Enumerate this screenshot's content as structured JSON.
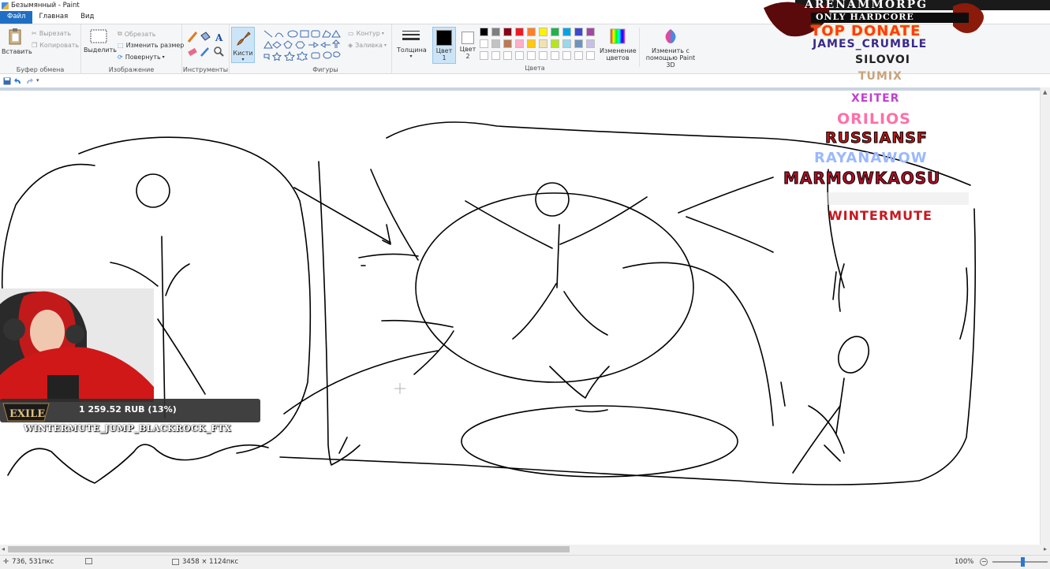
{
  "window": {
    "title": "Безымянный - Paint"
  },
  "tabs": [
    {
      "label": "Файл"
    },
    {
      "label": "Главная"
    },
    {
      "label": "Вид"
    }
  ],
  "ribbon": {
    "clipboard": {
      "paste": "Вставить",
      "cut": "Вырезать",
      "copy": "Копировать",
      "label": "Буфер обмена"
    },
    "image": {
      "select": "Выделить",
      "crop": "Обрезать",
      "resize": "Изменить размер",
      "rotate": "Повернуть",
      "label": "Изображение"
    },
    "tools": {
      "label": "Инструменты"
    },
    "brushes": {
      "label": "Кисти"
    },
    "shapes": {
      "outline": "Контур",
      "fill": "Заливка",
      "label": "Фигуры"
    },
    "size": {
      "label": "Толщина"
    },
    "color1": {
      "label": "Цвет 1"
    },
    "color2": {
      "label": "Цвет 2"
    },
    "colors": {
      "label": "Цвета",
      "edit": "Изменение цветов",
      "paint3d": "Изменить с помощью Paint 3D"
    },
    "palette_row1": [
      "#000000",
      "#7f7f7f",
      "#880015",
      "#ed1c24",
      "#ff7f27",
      "#fff200",
      "#22b14c",
      "#00a2e8",
      "#3f48cc",
      "#a349a4"
    ],
    "palette_row2": [
      "#ffffff",
      "#c3c3c3",
      "#b97a57",
      "#ffaec9",
      "#ffc90e",
      "#efe4b0",
      "#b5e61d",
      "#99d9ea",
      "#7092be",
      "#c8bfe7"
    ]
  },
  "status": {
    "cursor": "736, 531пкс",
    "size": "3458 × 1124пкс",
    "zoom": "100%"
  },
  "overlay": {
    "brand": "ARENAMMORPG",
    "tagline": "ONLY HARDCORE",
    "top_title": "TOP DONATE",
    "donors": [
      {
        "name": "JAMES_CRUMBLE",
        "color": "#3a2a8a"
      },
      {
        "name": "SILOVOI",
        "color": "#222222"
      },
      {
        "name": "TUMIX",
        "color": "#c9a27a"
      },
      {
        "name": "XEITER",
        "color": "#c040d0"
      },
      {
        "name": "ORILIOS",
        "color": "#ff6fa8"
      },
      {
        "name": "RUSSIANSF",
        "color": "#c01818"
      },
      {
        "name": "RAYANAWOW",
        "color": "#9bb8ff"
      },
      {
        "name": "MARMOWKAOSU",
        "color": "#b01028"
      },
      {
        "name": "WINTERMUTE",
        "color": "#c81820"
      }
    ],
    "donation_amount": "1 259.52 RUB (13%)",
    "ticker": "WINTERMUTE_JUMP_BLACKROCK_FTX"
  }
}
